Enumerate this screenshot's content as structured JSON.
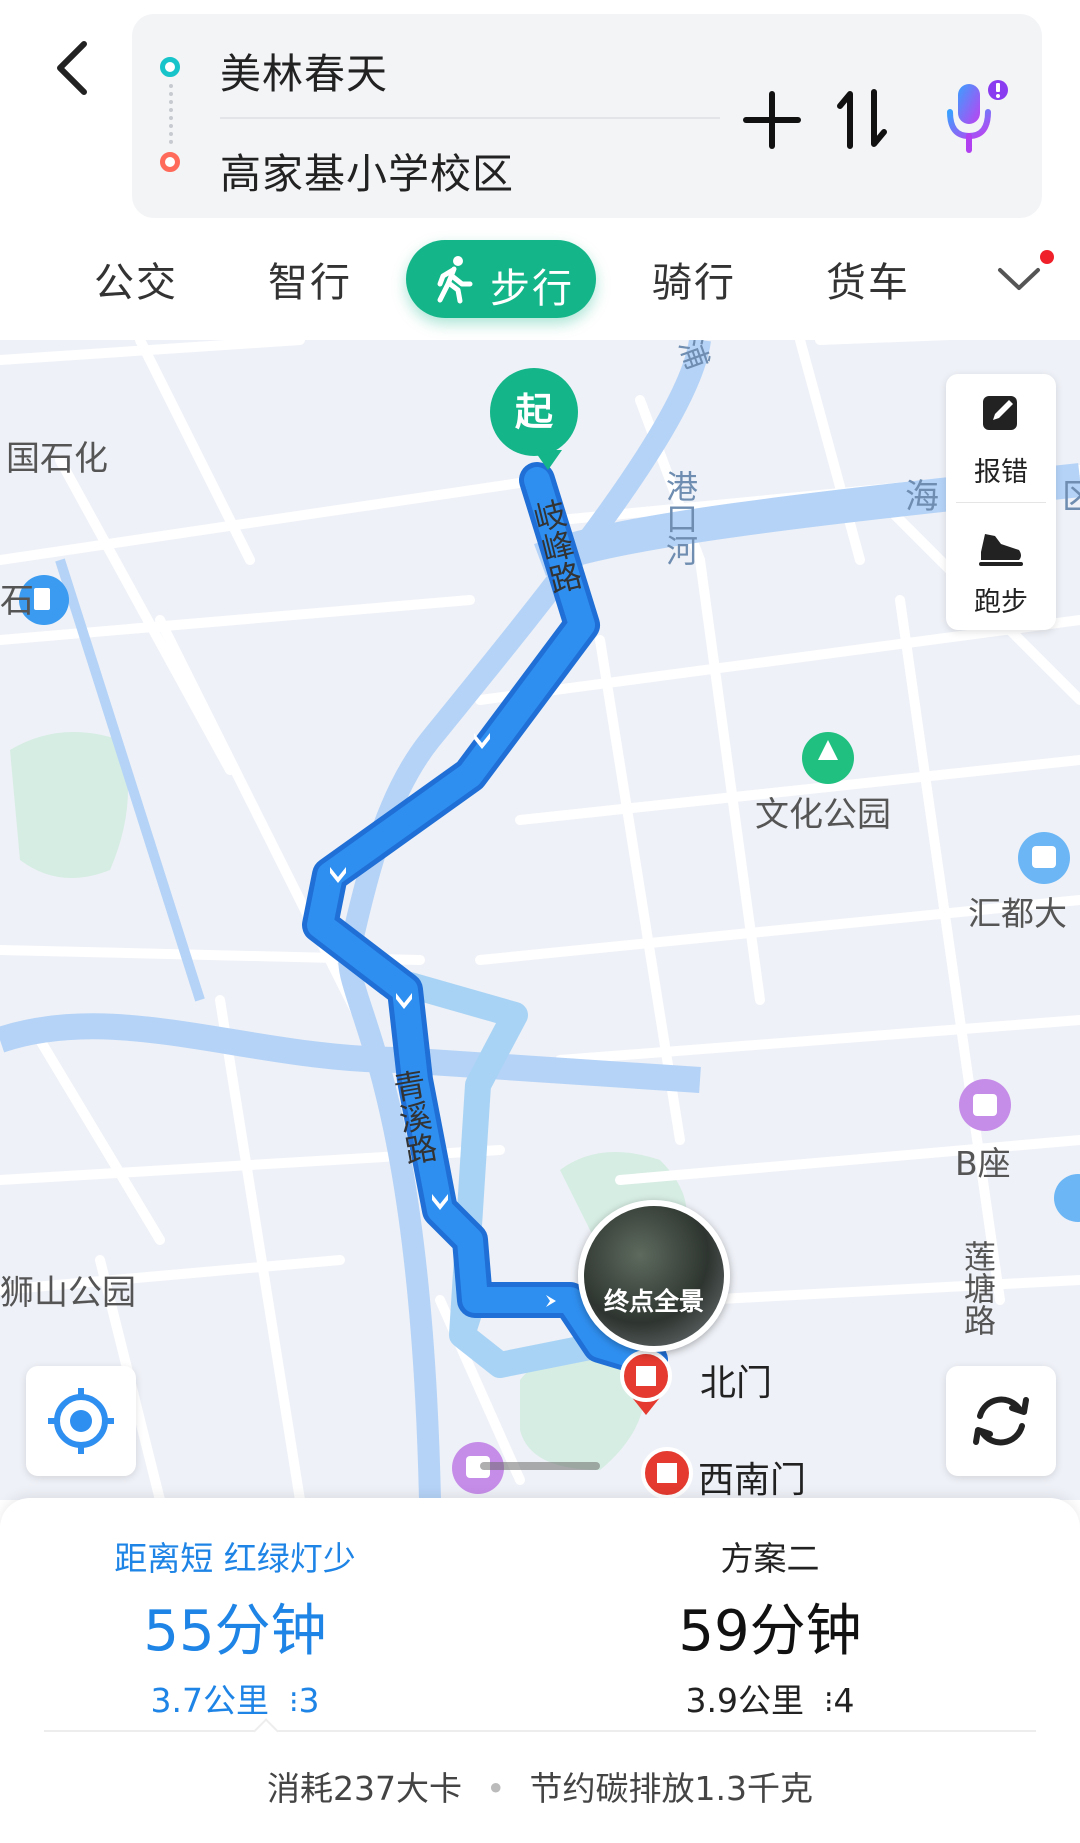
{
  "route": {
    "origin": "美林春天",
    "destination": "高家基小学校区"
  },
  "tabs": {
    "bus": "公交",
    "smart": "智行",
    "walk": "步行",
    "ride": "骑行",
    "truck": "货车",
    "active": "walk"
  },
  "map": {
    "labels": {
      "start_marker": "起",
      "road_qifeng": "岐峰路",
      "road_qingxi": "青溪路",
      "river_gangkou": "港口河",
      "culture_park": "文化公园",
      "guoshihua": "国石化",
      "huidu": "汇都大",
      "b_zuo": "B座",
      "liantang_road": "莲塘路",
      "shishan_park": "狮山公园",
      "north_gate": "北门",
      "southwest_gate": "西南门",
      "hai": "海",
      "qu": "区",
      "pu": "浦",
      "shi": "石"
    },
    "tools": {
      "report": "报错",
      "run": "跑步"
    },
    "panorama_label": "终点全景"
  },
  "plans": [
    {
      "tag": "距离短 红绿灯少",
      "time": "55分钟",
      "distance": "3.7公里",
      "lights": "3",
      "selected": true
    },
    {
      "tag": "方案二",
      "time": "59分钟",
      "distance": "3.9公里",
      "lights": "4",
      "selected": false
    }
  ],
  "stats": {
    "calories": "消耗237大卡",
    "carbon": "节约碳排放1.3千克"
  },
  "colors": {
    "accent_green": "#13b589",
    "route_blue": "#2f8ff0",
    "alt_route": "#a9d3f5",
    "selected_text": "#1e84e6",
    "start_dot": "#17c4c9",
    "end_dot": "#ff6a5a"
  }
}
